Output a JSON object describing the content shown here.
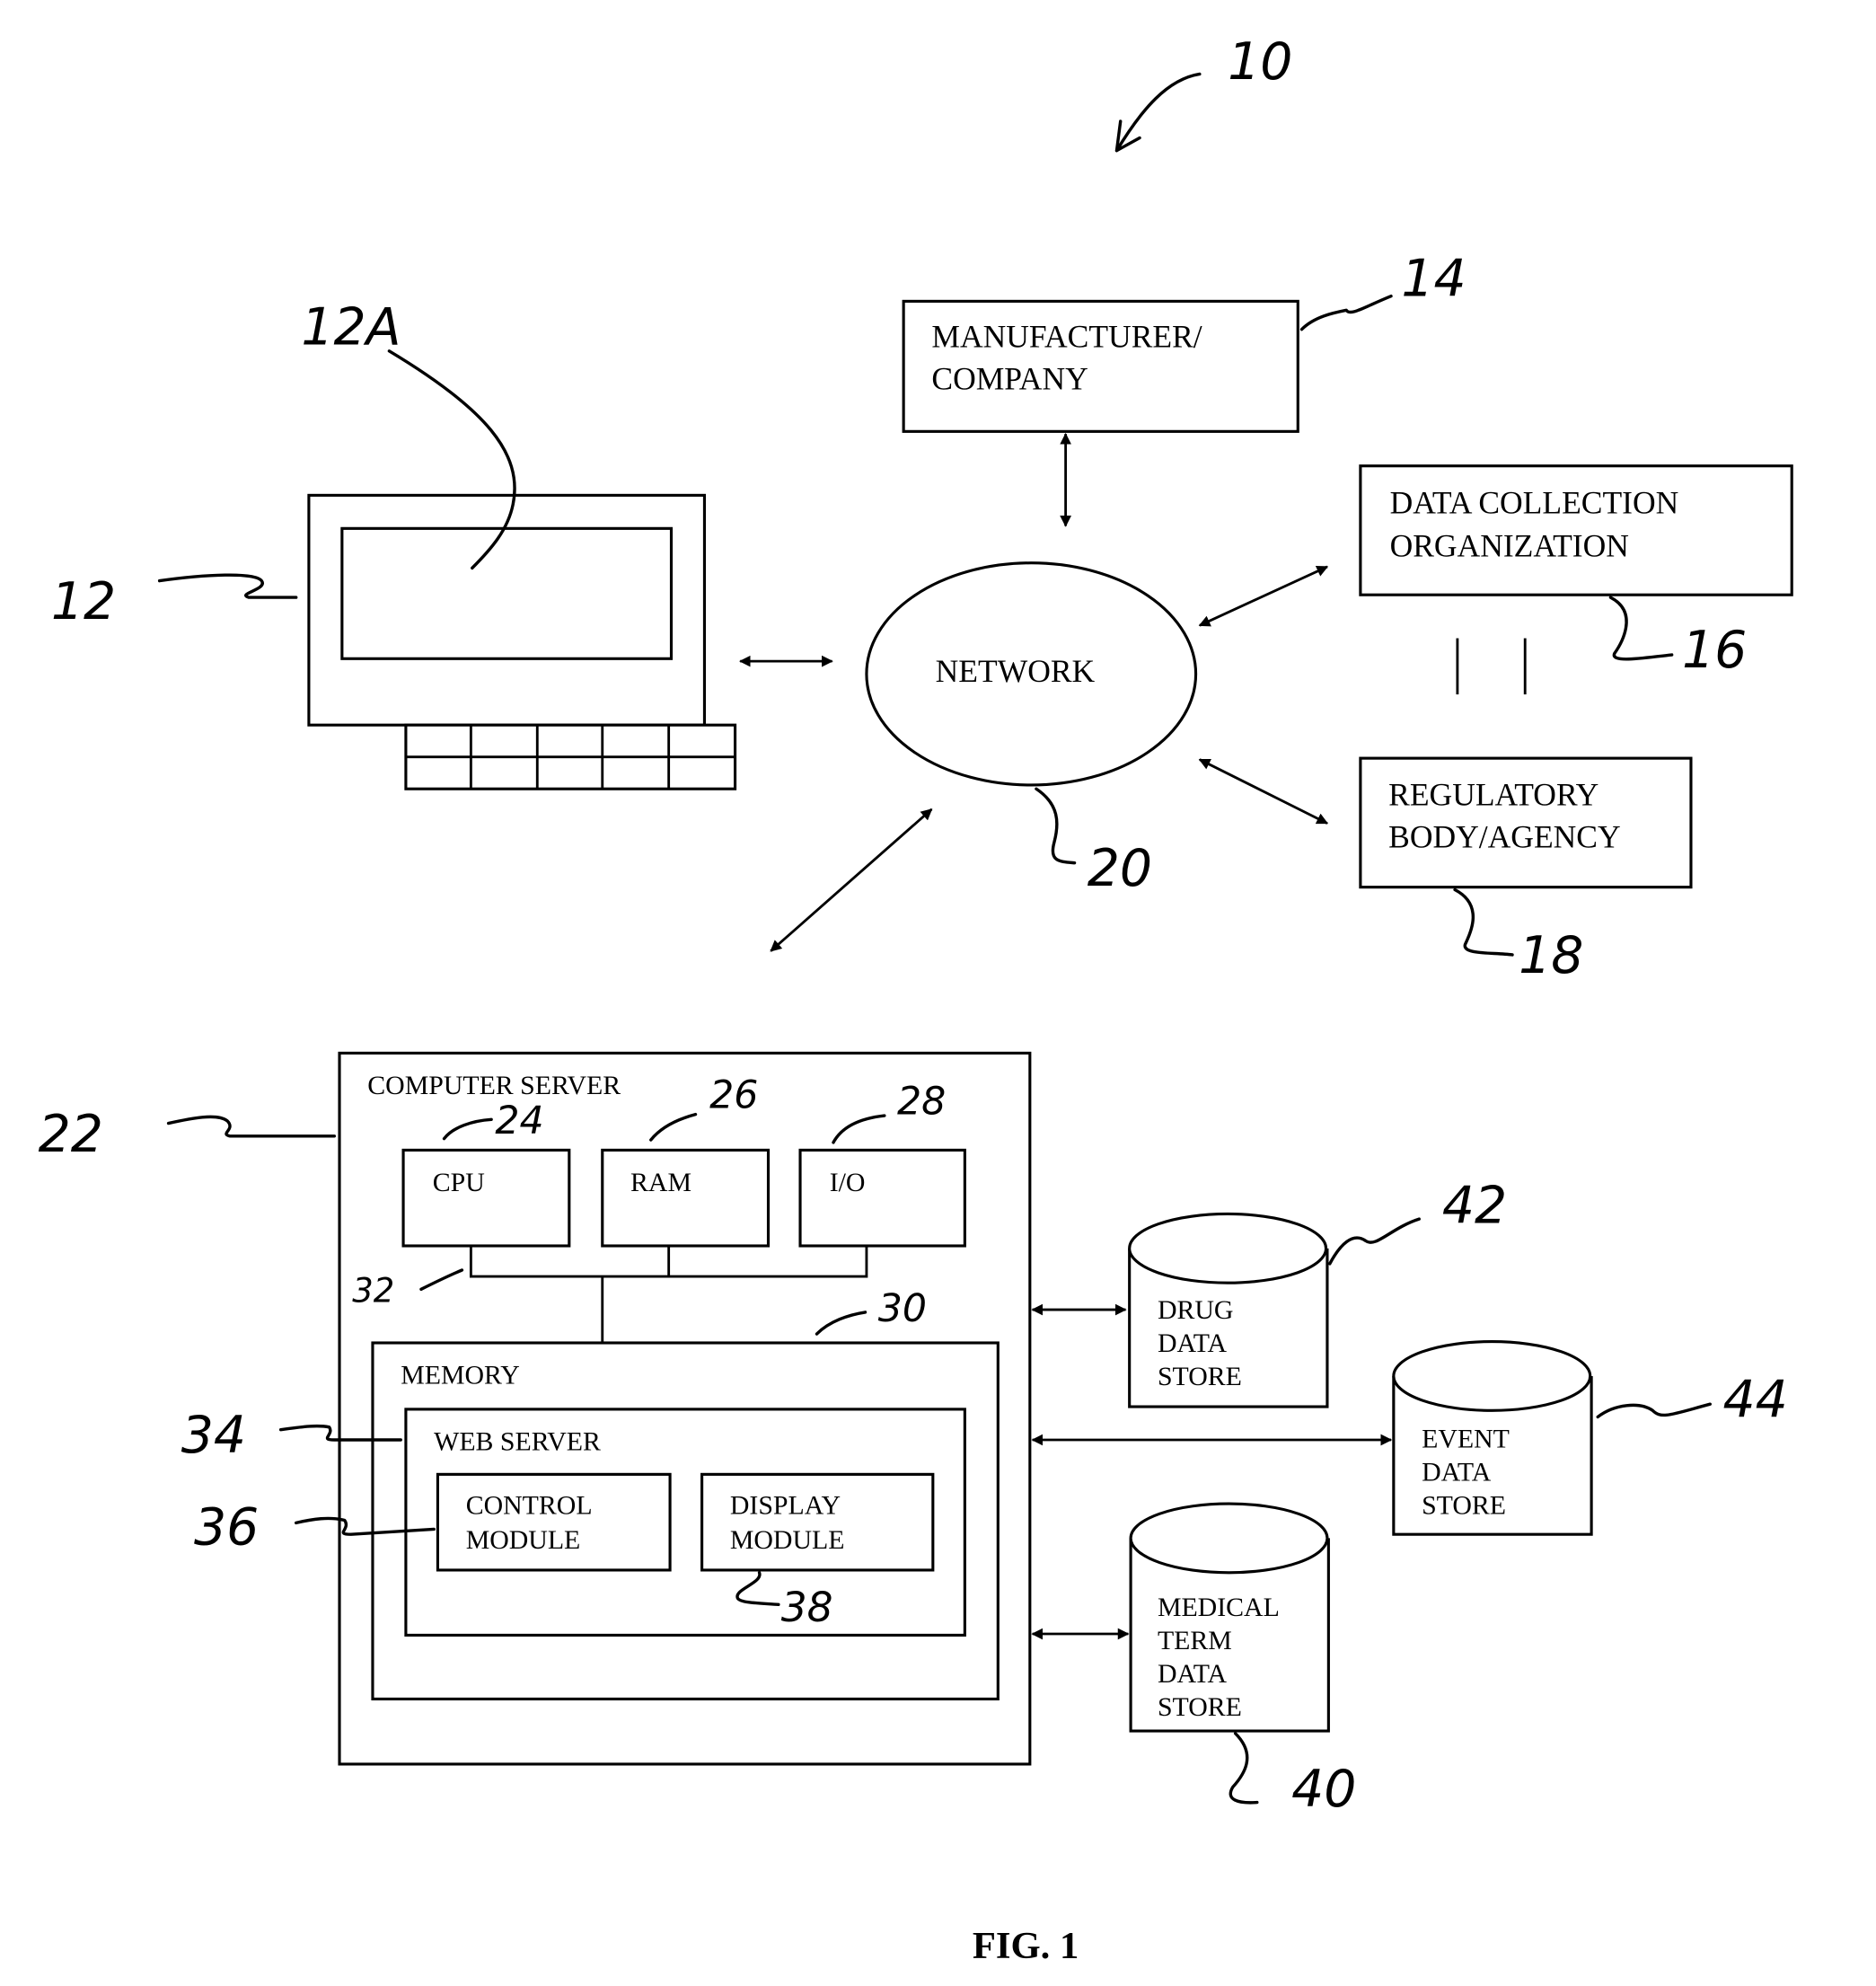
{
  "figure": {
    "caption": "FIG. 1",
    "system_ref": "10"
  },
  "client": {
    "ref": "12",
    "screen_ref": "12A"
  },
  "network": {
    "label": "NETWORK",
    "ref": "20"
  },
  "manufacturer": {
    "line1": "MANUFACTURER/",
    "line2": "COMPANY",
    "ref": "14"
  },
  "data_collection": {
    "line1": "DATA COLLECTION",
    "line2": "ORGANIZATION",
    "ref": "16"
  },
  "regulatory": {
    "line1": "REGULATORY",
    "line2": "BODY/AGENCY",
    "ref": "18"
  },
  "server": {
    "title": "COMPUTER SERVER",
    "ref": "22",
    "bus_ref": "32",
    "cpu": {
      "label": "CPU",
      "ref": "24"
    },
    "ram": {
      "label": "RAM",
      "ref": "26"
    },
    "io": {
      "label": "I/O",
      "ref": "28"
    },
    "memory": {
      "label": "MEMORY",
      "ref": "30",
      "web_server": {
        "label": "WEB SERVER",
        "ref": "34",
        "control_module": {
          "line1": "CONTROL",
          "line2": "MODULE",
          "ref": "36"
        },
        "display_module": {
          "line1": "DISPLAY",
          "line2": "MODULE",
          "ref": "38"
        }
      }
    }
  },
  "stores": {
    "drug": {
      "lines": [
        "DRUG",
        "DATA",
        "STORE"
      ],
      "ref": "42"
    },
    "event": {
      "lines": [
        "EVENT",
        "DATA",
        "STORE"
      ],
      "ref": "44"
    },
    "medical_term": {
      "lines": [
        "MEDICAL",
        "TERM",
        "DATA",
        "STORE"
      ],
      "ref": "40"
    }
  }
}
